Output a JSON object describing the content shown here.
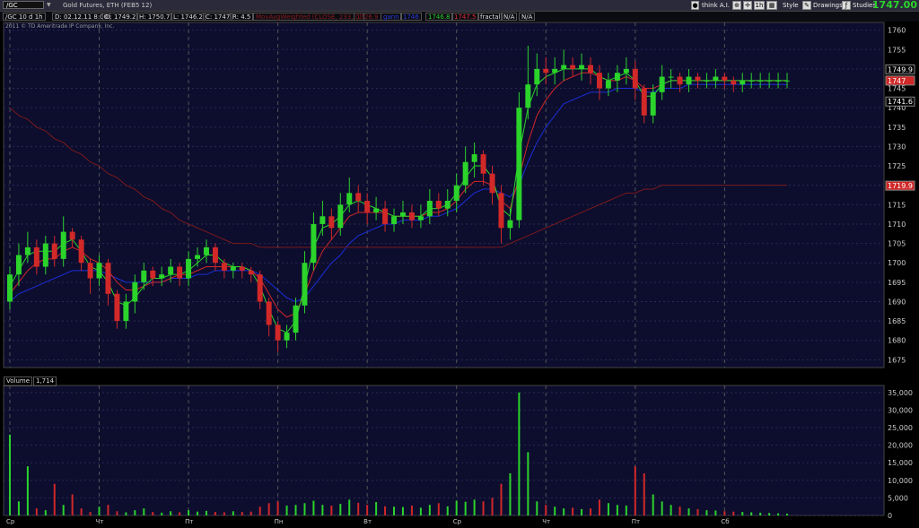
{
  "toolbar": {
    "symbol": "/GC",
    "description": "Gold Futures, ETH (FEB5 12)",
    "think_ai": "think A.I.",
    "timeframe": "1h",
    "style": "Style",
    "drawings": "Drawings",
    "studies": "Studies",
    "last_price": "1747.00",
    "colors": {
      "up": "#2bd32b",
      "down": "#d12828",
      "bg": "#0d0d2e"
    }
  },
  "info": {
    "period": "/GC 10 d 1h",
    "date": "D: 02.12.11 8:00",
    "open": "O: 1749.2",
    "high": "H: 1750.7",
    "low": "L: 1746.2",
    "close": "C: 1747",
    "range": "R: 4.5",
    "study": "MovAvgWeighted (CLOSE, 233, 0)",
    "study_value": "1726.9",
    "study2": "gann",
    "study2_value": "1746",
    "v1": "1746.8",
    "v2": "1747.5",
    "fractal": "fractal",
    "na1": "N/A",
    "na2": "N/A"
  },
  "copyright": "2011 © TD Ameritrade IP Company, Inc.",
  "volume": {
    "label": "Volume",
    "value": "1,714"
  },
  "chart_data": {
    "type": "candlestick",
    "price_ticks": [
      1760,
      1755,
      1750,
      1745,
      1740,
      1735,
      1730,
      1725,
      1720,
      1715,
      1710,
      1705,
      1700,
      1695,
      1690,
      1685,
      1680,
      1675
    ],
    "price_labels": [
      "1760",
      "1755",
      "1750",
      "1745",
      "1740",
      "1735",
      "1730",
      "1725",
      "1720",
      "1715",
      "1710",
      "1705",
      "1700",
      "1695",
      "1690",
      "1685",
      "1680",
      "1675"
    ],
    "ylim": [
      1673,
      1762
    ],
    "price_markers": [
      {
        "label": "1749.9",
        "value": 1749.9,
        "color": "#000000",
        "text": "#ffffff"
      },
      {
        "label": "1747",
        "value": 1747.0,
        "color": "#d12828",
        "text": "#ffffff"
      },
      {
        "label": "1741.6",
        "value": 1741.6,
        "color": "#000000",
        "text": "#ffffff"
      },
      {
        "label": "1719.9",
        "value": 1719.9,
        "color": "#d12828",
        "text": "#ffffff"
      }
    ],
    "volume_ticks": [
      35000,
      30000,
      25000,
      20000,
      15000,
      10000,
      5000,
      0
    ],
    "volume_labels": [
      "35,000",
      "30,000",
      "25,000",
      "20,000",
      "15,000",
      "10,000",
      "5,000",
      "0"
    ],
    "volume_ylim": [
      0,
      37000
    ],
    "day_labels": [
      "Ср",
      "Чт",
      "Пт",
      "Пн",
      "Вт",
      "Ср",
      "Чт",
      "Пт",
      "Сб"
    ],
    "day_positions": [
      0,
      10,
      20,
      30,
      40,
      50,
      60,
      70,
      80
    ],
    "bar_count": 88,
    "close": [
      1697,
      1702,
      1704,
      1699,
      1705,
      1701,
      1708,
      1706,
      1700,
      1696,
      1700,
      1692,
      1685,
      1690,
      1695,
      1698,
      1696,
      1697,
      1699,
      1696,
      1701,
      1702,
      1704,
      1700,
      1698,
      1699,
      1698,
      1697,
      1690,
      1684,
      1680,
      1682,
      1689,
      1700,
      1710,
      1712,
      1709,
      1715,
      1718,
      1716,
      1713,
      1714,
      1710,
      1712,
      1713,
      1711,
      1712,
      1716,
      1714,
      1716,
      1720,
      1726,
      1728,
      1723,
      1718,
      1709,
      1711,
      1740,
      1746,
      1750,
      1749,
      1750,
      1751,
      1750,
      1751,
      1749,
      1745,
      1747,
      1749,
      1750,
      1745,
      1738,
      1744,
      1748,
      1748,
      1746,
      1748,
      1747,
      1747,
      1748,
      1747,
      1746,
      1747,
      1747,
      1747,
      1747,
      1747,
      1747
    ],
    "open": [
      1690,
      1697,
      1702,
      1704,
      1699,
      1705,
      1701,
      1708,
      1706,
      1700,
      1696,
      1700,
      1692,
      1685,
      1690,
      1695,
      1698,
      1696,
      1697,
      1699,
      1696,
      1701,
      1702,
      1704,
      1700,
      1698,
      1699,
      1698,
      1697,
      1690,
      1684,
      1680,
      1682,
      1689,
      1700,
      1710,
      1712,
      1709,
      1715,
      1718,
      1716,
      1713,
      1714,
      1710,
      1712,
      1713,
      1711,
      1712,
      1716,
      1714,
      1716,
      1720,
      1726,
      1728,
      1723,
      1718,
      1709,
      1711,
      1740,
      1746,
      1750,
      1749,
      1750,
      1751,
      1750,
      1751,
      1749,
      1745,
      1747,
      1749,
      1750,
      1745,
      1738,
      1744,
      1748,
      1748,
      1746,
      1748,
      1747,
      1747,
      1748,
      1747,
      1746,
      1747,
      1747,
      1747,
      1747,
      1747
    ],
    "high": [
      1699,
      1705,
      1708,
      1706,
      1707,
      1707,
      1712,
      1709,
      1707,
      1701,
      1702,
      1701,
      1693,
      1692,
      1697,
      1700,
      1699,
      1699,
      1701,
      1700,
      1703,
      1704,
      1706,
      1705,
      1701,
      1700,
      1700,
      1699,
      1698,
      1691,
      1685,
      1684,
      1691,
      1703,
      1713,
      1716,
      1714,
      1718,
      1722,
      1720,
      1718,
      1717,
      1716,
      1714,
      1716,
      1715,
      1715,
      1719,
      1718,
      1719,
      1723,
      1730,
      1731,
      1729,
      1725,
      1720,
      1714,
      1744,
      1756,
      1754,
      1753,
      1753,
      1755,
      1753,
      1754,
      1753,
      1751,
      1749,
      1751,
      1753,
      1752,
      1746,
      1746,
      1751,
      1750,
      1749,
      1750,
      1749,
      1749,
      1750,
      1749,
      1748,
      1749,
      1749,
      1749,
      1749,
      1749,
      1749
    ],
    "low": [
      1688,
      1694,
      1700,
      1697,
      1697,
      1699,
      1699,
      1704,
      1698,
      1692,
      1694,
      1689,
      1683,
      1683,
      1687,
      1693,
      1694,
      1694,
      1695,
      1694,
      1694,
      1699,
      1700,
      1698,
      1696,
      1696,
      1696,
      1695,
      1688,
      1681,
      1677,
      1678,
      1680,
      1687,
      1698,
      1707,
      1706,
      1707,
      1713,
      1713,
      1710,
      1711,
      1708,
      1708,
      1710,
      1709,
      1709,
      1710,
      1712,
      1712,
      1713,
      1718,
      1722,
      1720,
      1715,
      1705,
      1706,
      1709,
      1737,
      1743,
      1746,
      1746,
      1747,
      1748,
      1747,
      1746,
      1742,
      1743,
      1744,
      1746,
      1742,
      1736,
      1736,
      1742,
      1745,
      1744,
      1744,
      1745,
      1745,
      1745,
      1745,
      1744,
      1744,
      1745,
      1745,
      1745,
      1745,
      1745
    ],
    "volume": [
      23000,
      4000,
      14000,
      2000,
      1500,
      9000,
      3000,
      6000,
      2000,
      1000,
      2500,
      3000,
      1200,
      900,
      1500,
      2000,
      1000,
      800,
      1200,
      900,
      1500,
      1100,
      1300,
      1000,
      900,
      1200,
      1000,
      1100,
      2500,
      3500,
      4000,
      2800,
      3000,
      3500,
      4200,
      3000,
      2800,
      3300,
      4500,
      3600,
      3000,
      3800,
      2600,
      2500,
      2400,
      2800,
      2200,
      3000,
      3500,
      2600,
      4200,
      3900,
      4500,
      4000,
      5000,
      9000,
      12000,
      35000,
      18000,
      4000,
      3000,
      2500,
      2000,
      2200,
      1800,
      2000,
      4500,
      3500,
      3000,
      2800,
      14000,
      12000,
      6000,
      4000,
      3000,
      2500,
      2000,
      1800,
      1500,
      1400,
      1200,
      1100,
      1000,
      900,
      800,
      700,
      600,
      500
    ],
    "series": [
      {
        "name": "",
        "color": "#1a2fd6",
        "values": [
          1690,
          1692,
          1693,
          1694,
          1695,
          1696,
          1697,
          1698,
          1698,
          1698,
          1698,
          1697,
          1696,
          1695,
          1695,
          1695,
          1695,
          1695,
          1696,
          1696,
          1696,
          1697,
          1697,
          1698,
          1698,
          1698,
          1698,
          1698,
          1697,
          1695,
          1693,
          1691,
          1690,
          1691,
          1694,
          1697,
          1700,
          1702,
          1705,
          1707,
          1708,
          1709,
          1710,
          1710,
          1711,
          1711,
          1711,
          1712,
          1712,
          1713,
          1714,
          1716,
          1718,
          1719,
          1719,
          1718,
          1717,
          1720,
          1726,
          1731,
          1735,
          1738,
          1741,
          1742,
          1743,
          1744,
          1744,
          1744,
          1745,
          1745,
          1745,
          1744,
          1744,
          1745,
          1745,
          1745,
          1746,
          1746,
          1746,
          1746,
          1746,
          1746,
          1746,
          1746,
          1746,
          1746,
          1746,
          1746
        ]
      },
      {
        "name": "",
        "color": "#d12828",
        "values": [
          1692,
          1695,
          1698,
          1700,
          1701,
          1701,
          1703,
          1704,
          1703,
          1701,
          1700,
          1698,
          1695,
          1693,
          1693,
          1694,
          1695,
          1695,
          1696,
          1697,
          1697,
          1698,
          1699,
          1699,
          1699,
          1699,
          1699,
          1698,
          1696,
          1692,
          1688,
          1686,
          1687,
          1692,
          1698,
          1703,
          1706,
          1709,
          1712,
          1713,
          1713,
          1713,
          1713,
          1712,
          1712,
          1712,
          1712,
          1713,
          1713,
          1714,
          1716,
          1719,
          1721,
          1721,
          1720,
          1716,
          1714,
          1722,
          1731,
          1738,
          1742,
          1745,
          1747,
          1748,
          1749,
          1749,
          1748,
          1747,
          1747,
          1748,
          1747,
          1745,
          1745,
          1746,
          1747,
          1747,
          1747,
          1747,
          1747,
          1747,
          1747,
          1747,
          1747,
          1747,
          1747,
          1747,
          1747,
          1747
        ]
      },
      {
        "name": "",
        "color": "#2bd32b",
        "values": [
          1694,
          1698,
          1702,
          1703,
          1703,
          1703,
          1705,
          1706,
          1703,
          1699,
          1698,
          1695,
          1690,
          1689,
          1691,
          1694,
          1696,
          1696,
          1697,
          1697,
          1698,
          1700,
          1702,
          1702,
          1700,
          1699,
          1699,
          1698,
          1694,
          1688,
          1683,
          1682,
          1685,
          1694,
          1704,
          1709,
          1710,
          1712,
          1715,
          1716,
          1715,
          1714,
          1713,
          1712,
          1712,
          1712,
          1712,
          1714,
          1714,
          1715,
          1718,
          1722,
          1725,
          1725,
          1722,
          1714,
          1712,
          1728,
          1740,
          1746,
          1748,
          1749,
          1750,
          1750,
          1750,
          1750,
          1748,
          1747,
          1748,
          1749,
          1747,
          1743,
          1743,
          1746,
          1747,
          1747,
          1747,
          1747,
          1747,
          1747,
          1747,
          1747,
          1747,
          1747,
          1747,
          1747,
          1747,
          1747
        ]
      },
      {
        "name": "",
        "color": "#7a1a1a",
        "values": [
          1740,
          1738,
          1737,
          1735,
          1734,
          1732,
          1731,
          1729,
          1728,
          1726,
          1725,
          1723,
          1722,
          1720,
          1719,
          1717,
          1716,
          1714,
          1713,
          1711,
          1710,
          1709,
          1708,
          1707,
          1706,
          1705,
          1705,
          1705,
          1704,
          1704,
          1704,
          1704,
          1704,
          1704,
          1704,
          1704,
          1704,
          1704,
          1704,
          1704,
          1704,
          1704,
          1704,
          1704,
          1704,
          1704,
          1704,
          1704,
          1704,
          1704,
          1704,
          1704,
          1704,
          1704,
          1704,
          1704,
          1705,
          1706,
          1707,
          1708,
          1709,
          1710,
          1711,
          1712,
          1713,
          1714,
          1715,
          1716,
          1717,
          1718,
          1718,
          1719,
          1719,
          1720,
          1720,
          1720,
          1720,
          1720,
          1720,
          1720,
          1720,
          1720,
          1720,
          1720,
          1720,
          1720,
          1720,
          1720
        ]
      }
    ]
  }
}
